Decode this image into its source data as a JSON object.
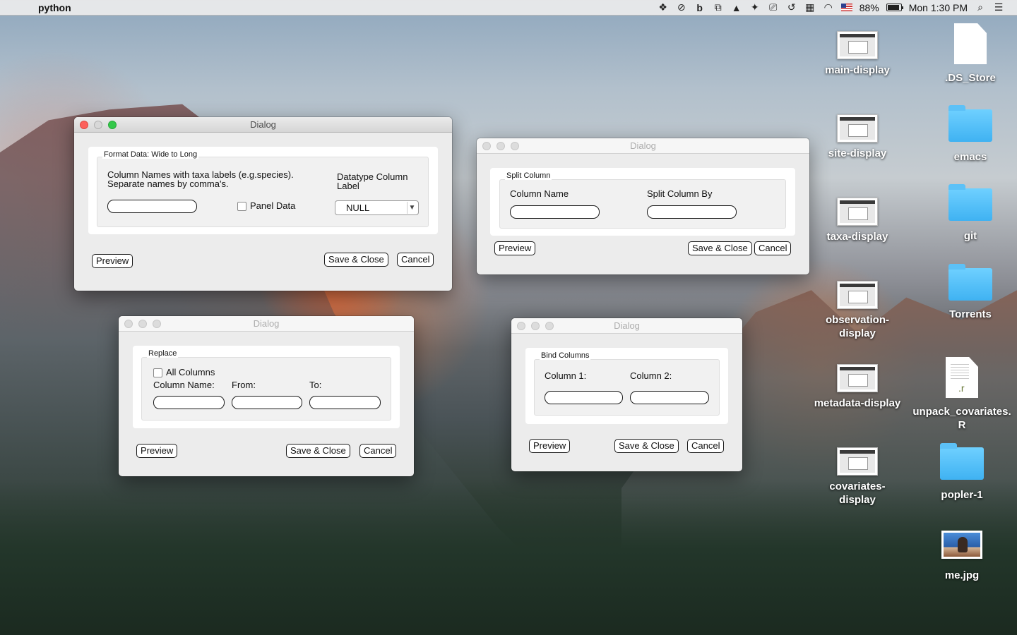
{
  "menubar": {
    "apple_glyph": "",
    "app_name": "python",
    "status_icons": [
      "dropbox-icon",
      "sync-icon",
      "b-icon",
      "crop-icon",
      "drive-icon",
      "evernote-icon",
      "airplay-icon",
      "time-machine-icon",
      "keyboard-icon",
      "wifi-icon",
      "us-flag-icon",
      "battery-icon"
    ],
    "battery_percent": "88%",
    "clock": "Mon 1:30 PM"
  },
  "dialogs": {
    "format": {
      "title": "Dialog",
      "group_label": "Format Data: Wide to Long",
      "column_names_label_line1": "Column Names with taxa labels (e.g.species).",
      "column_names_label_line2": "Separate names by comma's.",
      "datatype_label_line1": "Datatype Column",
      "datatype_label_line2": "Label",
      "panel_data_label": "Panel Data",
      "datatype_selected": "NULL",
      "preview_label": "Preview",
      "save_label": "Save & Close",
      "cancel_label": "Cancel"
    },
    "split": {
      "title": "Dialog",
      "group_label": "Split Column",
      "column_name_label": "Column Name",
      "split_by_label": "Split Column By",
      "preview_label": "Preview",
      "save_label": "Save & Close",
      "cancel_label": "Cancel"
    },
    "replace": {
      "title": "Dialog",
      "group_label": "Replace",
      "all_columns_label": "All Columns",
      "column_name_label": "Column Name:",
      "from_label": "From:",
      "to_label": "To:",
      "preview_label": "Preview",
      "save_label": "Save & Close",
      "cancel_label": "Cancel"
    },
    "bind": {
      "title": "Dialog",
      "group_label": "Bind Columns",
      "column1_label": "Column 1:",
      "column2_label": "Column 2:",
      "preview_label": "Preview",
      "save_label": "Save & Close",
      "cancel_label": "Cancel"
    }
  },
  "desktop": {
    "icons": [
      {
        "label": "main-display",
        "kind": "screenshot-thumbnail"
      },
      {
        "label": ".DS_Store",
        "kind": "document"
      },
      {
        "label": "site-display",
        "kind": "screenshot-thumbnail"
      },
      {
        "label": "emacs",
        "kind": "folder"
      },
      {
        "label": "taxa-display",
        "kind": "screenshot-thumbnail"
      },
      {
        "label": "git",
        "kind": "folder"
      },
      {
        "label": "observation-display",
        "kind": "screenshot-thumbnail"
      },
      {
        "label": "Torrents",
        "kind": "folder"
      },
      {
        "label": "metadata-display",
        "kind": "screenshot-thumbnail"
      },
      {
        "label": "unpack_covariates.R",
        "kind": "r-script-document",
        "ext_glyph": ".r"
      },
      {
        "label": "covariates-display",
        "kind": "screenshot-thumbnail"
      },
      {
        "label": "popler-1",
        "kind": "folder"
      },
      {
        "label": "me.jpg",
        "kind": "photo"
      }
    ]
  }
}
